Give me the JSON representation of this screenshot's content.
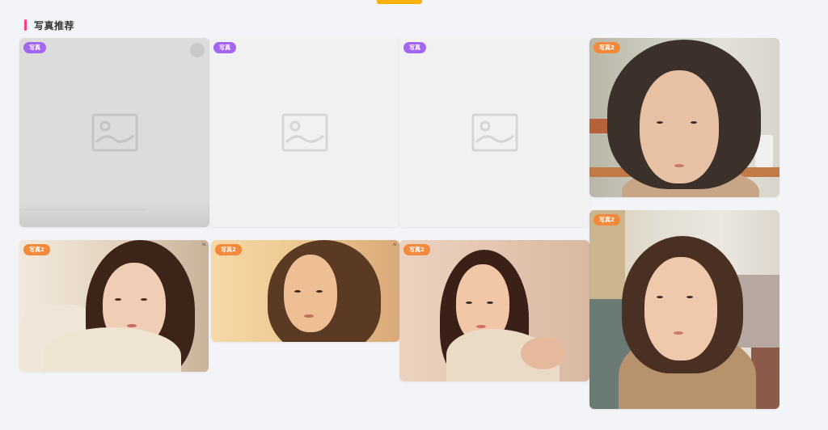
{
  "section": {
    "title": "写真推荐"
  },
  "cards": [
    {
      "badge": "写真",
      "badge_color": "purple",
      "state": "loading"
    },
    {
      "badge": "写真",
      "badge_color": "purple",
      "state": "loading"
    },
    {
      "badge": "写真",
      "badge_color": "purple",
      "state": "loading"
    },
    {
      "badge": "写真2",
      "badge_color": "orange",
      "state": "photo"
    },
    {
      "badge": "写真2",
      "badge_color": "orange",
      "state": "photo"
    },
    {
      "badge": "写真2",
      "badge_color": "orange",
      "state": "photo"
    },
    {
      "badge": "写真2",
      "badge_color": "orange",
      "state": "photo"
    },
    {
      "badge": "写真2",
      "badge_color": "orange",
      "state": "photo"
    }
  ],
  "colors": {
    "accent_bar": "#ff3d7f",
    "top_indicator": "#ffb000",
    "badge_purple": "#a465f0",
    "badge_orange": "#f3893a"
  },
  "icons": [
    "image-placeholder-icon"
  ]
}
